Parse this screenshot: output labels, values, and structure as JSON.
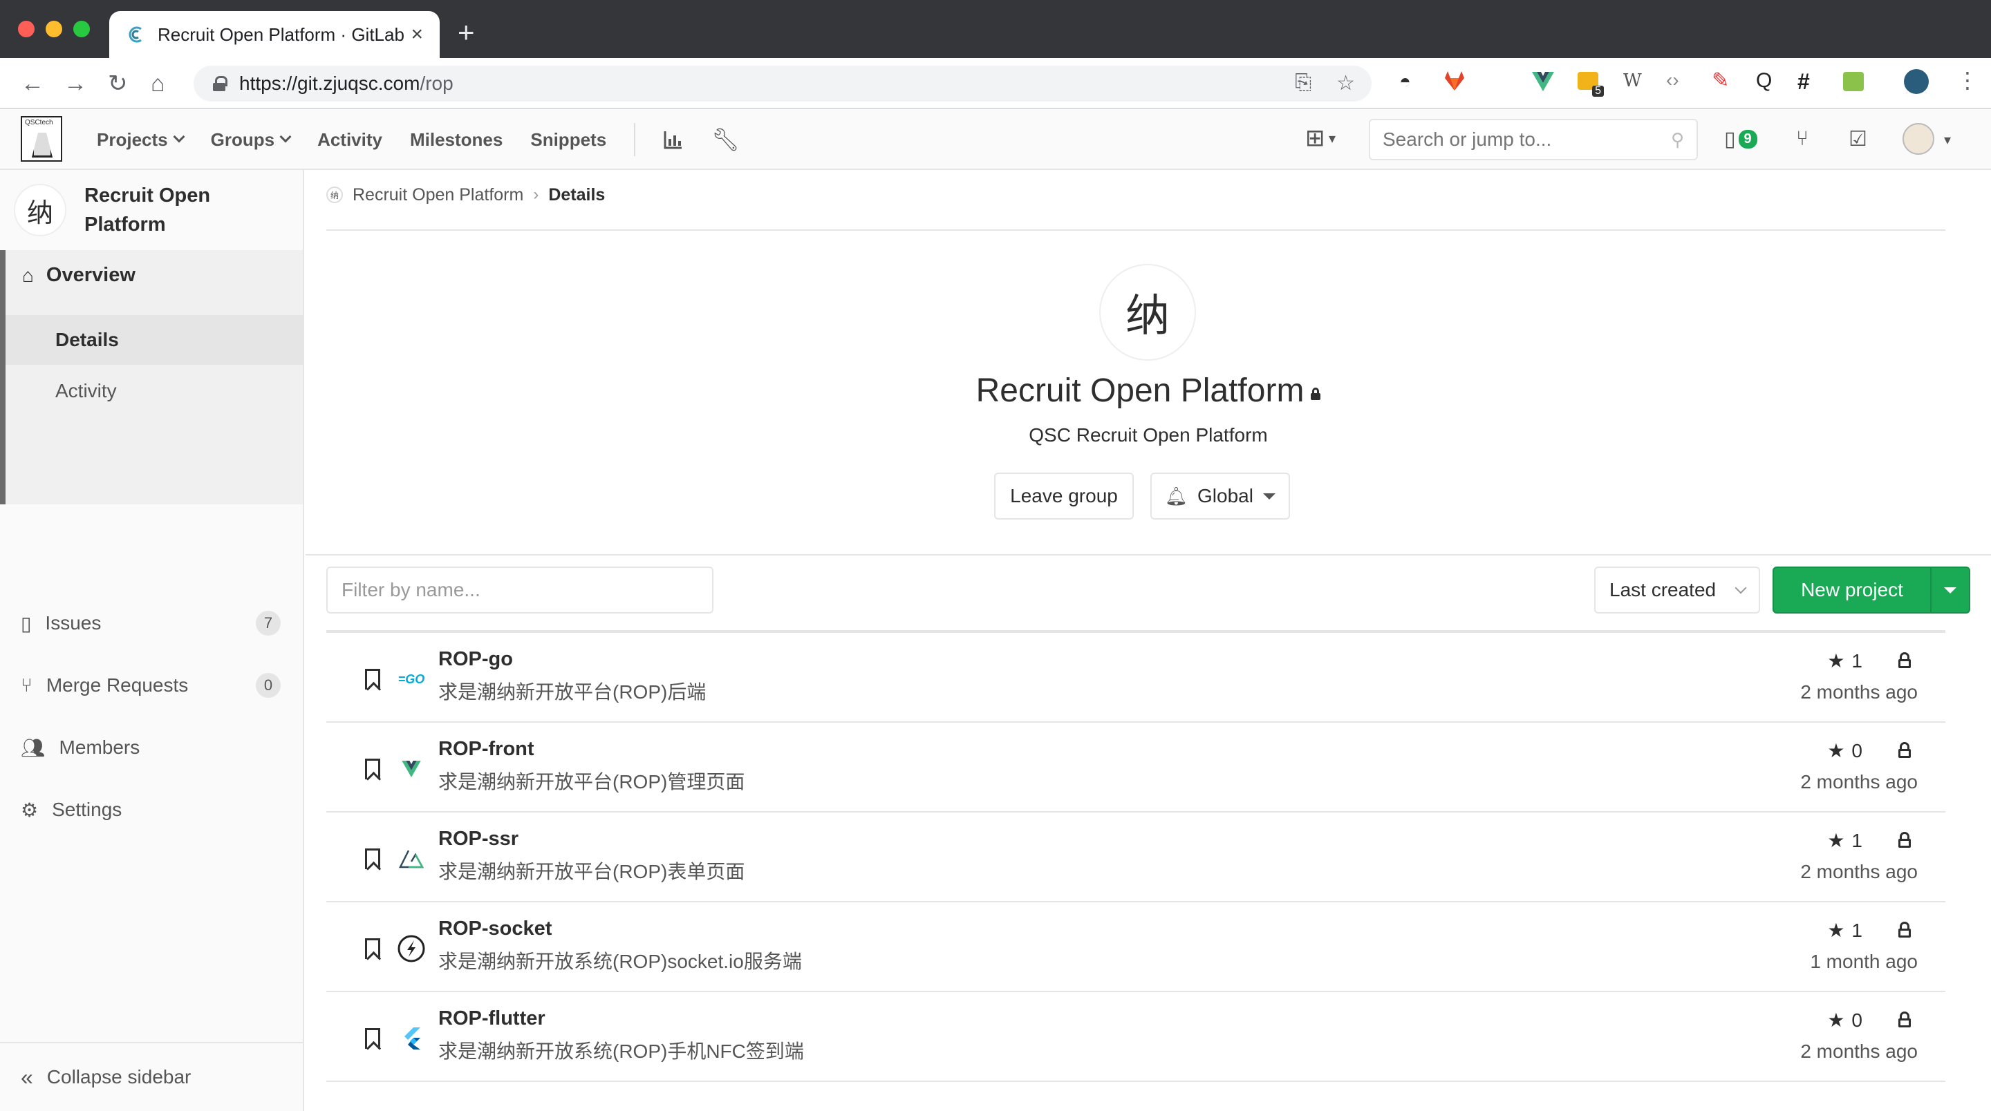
{
  "browser": {
    "tab_title": "Recruit Open Platform · GitLab",
    "url_host": "https://git.zjuqsc.com",
    "url_path": "/rop",
    "ext_badge": "5"
  },
  "gitlab_nav": {
    "logo_text": "QSCtech",
    "menu": [
      "Projects",
      "Groups",
      "Activity",
      "Milestones",
      "Snippets"
    ],
    "search_placeholder": "Search or jump to...",
    "todo_count": "9"
  },
  "sidebar": {
    "group_name": "Recruit Open Platform",
    "group_avatar_glyph": "纳",
    "overview": "Overview",
    "overview_sub": [
      "Details",
      "Activity"
    ],
    "items": [
      {
        "label": "Issues",
        "count": "7"
      },
      {
        "label": "Merge Requests",
        "count": "0"
      },
      {
        "label": "Members"
      },
      {
        "label": "Settings"
      }
    ],
    "collapse": "Collapse sidebar"
  },
  "main": {
    "breadcrumb": [
      "Recruit Open Platform",
      "Details"
    ],
    "group_title": "Recruit Open Platform",
    "group_description": "QSC Recruit Open Platform",
    "leave_group": "Leave group",
    "notification": "Global",
    "filter_placeholder": "Filter by name...",
    "sort": "Last created",
    "new_project": "New project",
    "projects": [
      {
        "name": "ROP-go",
        "description": "求是潮纳新开放平台(ROP)后端",
        "stars": "1",
        "updated": "2 months ago",
        "icon": "go-icon"
      },
      {
        "name": "ROP-front",
        "description": "求是潮纳新开放平台(ROP)管理页面",
        "stars": "0",
        "updated": "2 months ago",
        "icon": "vue-icon"
      },
      {
        "name": "ROP-ssr",
        "description": "求是潮纳新开放平台(ROP)表单页面",
        "stars": "1",
        "updated": "2 months ago",
        "icon": "nuxt-icon"
      },
      {
        "name": "ROP-socket",
        "description": "求是潮纳新开放系统(ROP)socket.io服务端",
        "stars": "1",
        "updated": "1 month ago",
        "icon": "socketio-icon"
      },
      {
        "name": "ROP-flutter",
        "description": "求是潮纳新开放系统(ROP)手机NFC签到端",
        "stars": "0",
        "updated": "2 months ago",
        "icon": "flutter-icon"
      }
    ]
  },
  "colors": {
    "accent_green": "#1aaa55",
    "chrome_dark": "#35363a"
  }
}
